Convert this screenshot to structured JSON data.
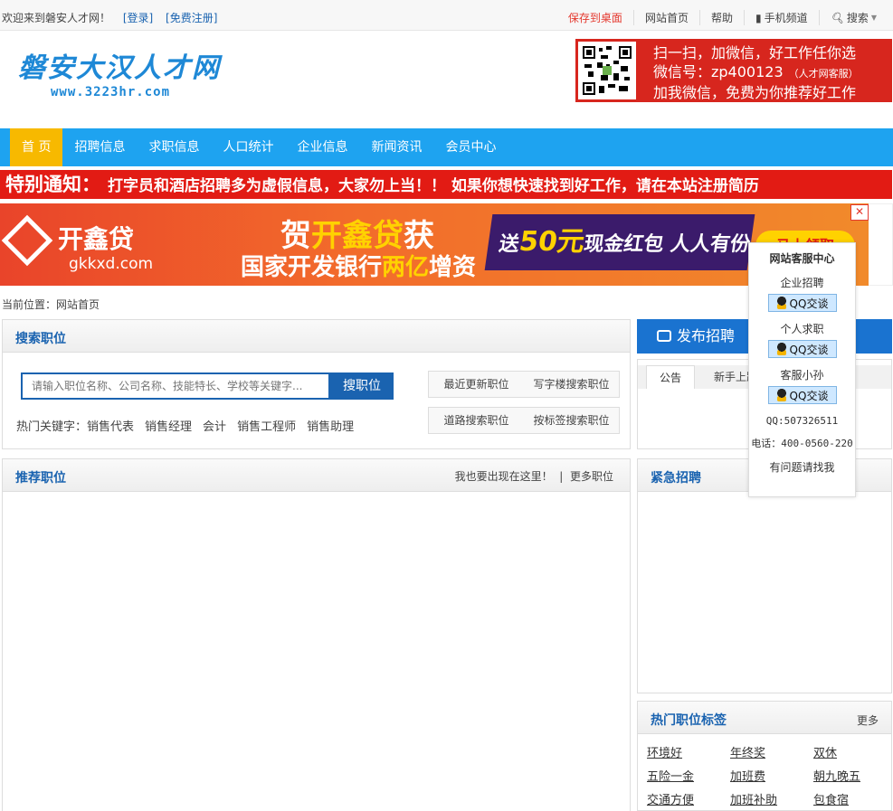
{
  "topbar": {
    "welcome": "欢迎来到磐安人才网！",
    "login": "[登录]",
    "register": "[免费注册]",
    "save_desktop": "保存到桌面",
    "home": "网站首页",
    "help": "帮助",
    "mobile": "手机频道",
    "search": "搜索"
  },
  "logo": {
    "title": "磐安大汉人才网",
    "url": "www.3223hr.com"
  },
  "qr_banner": {
    "line1": "扫一扫，加微信，好工作任你选",
    "line2": "微信号：zp400123",
    "line2_note": "（人才网客服）",
    "line3": "加我微信，免费为你推荐好工作"
  },
  "nav": [
    "首 页",
    "招聘信息",
    "求职信息",
    "人口统计",
    "企业信息",
    "新闻资讯",
    "会员中心"
  ],
  "notice": {
    "label": "特别通知：",
    "text": "打字员和酒店招聘多为虚假信息，大家勿上当！！ 如果你想快速找到好工作，请在本站注册简历"
  },
  "ad": {
    "brand": "开鑫贷",
    "brand_url": "gkkxd.com",
    "headline_pre": "贺",
    "headline_hl": "开鑫贷",
    "headline_post": "获",
    "sub_pre": "国家开发银行",
    "sub_hl": "两亿",
    "sub_post": "增资",
    "strip_pre": "送",
    "strip_hl": "50元",
    "strip_post": "现金红包 人人有份",
    "btn": "马上领取"
  },
  "crumb": "当前位置：网站首页",
  "search_panel": {
    "title": "搜索职位",
    "placeholder": "请输入职位名称、公司名称、技能特长、学校等关键字...",
    "button": "搜职位",
    "hot_label": "热门关键字：",
    "hot": [
      "销售代表",
      "销售经理",
      "会计",
      "销售工程师",
      "销售助理"
    ],
    "quick": [
      [
        "最近更新职位",
        "写字楼搜索职位"
      ],
      [
        "道路搜索职位",
        "按标签搜索职位"
      ]
    ]
  },
  "recommend": {
    "title": "推荐职位",
    "appear": "我也要出现在这里！",
    "more": "更多职位"
  },
  "publish": "发布招聘",
  "tabs": [
    "公告",
    "新手上路"
  ],
  "urgent": {
    "title": "紧急招聘"
  },
  "tags": {
    "title": "热门职位标签",
    "more": "更多",
    "items": [
      "环境好",
      "年终奖",
      "双休",
      "五险一金",
      "加班费",
      "朝九晚五",
      "交通方便",
      "加班补助",
      "包食宿"
    ]
  },
  "float": {
    "title": "网站客服中心",
    "groups": [
      "企业招聘",
      "个人求职",
      "客服小孙"
    ],
    "qq_label": "QQ交谈",
    "qq": "QQ:507326511",
    "phone": "电话：400-0560-220",
    "footer": "有问题请找我"
  },
  "colors": {
    "brand_blue": "#1ea3f0",
    "link_blue": "#1a63b0",
    "red": "#e21b14",
    "nav_active": "#f7b900"
  }
}
